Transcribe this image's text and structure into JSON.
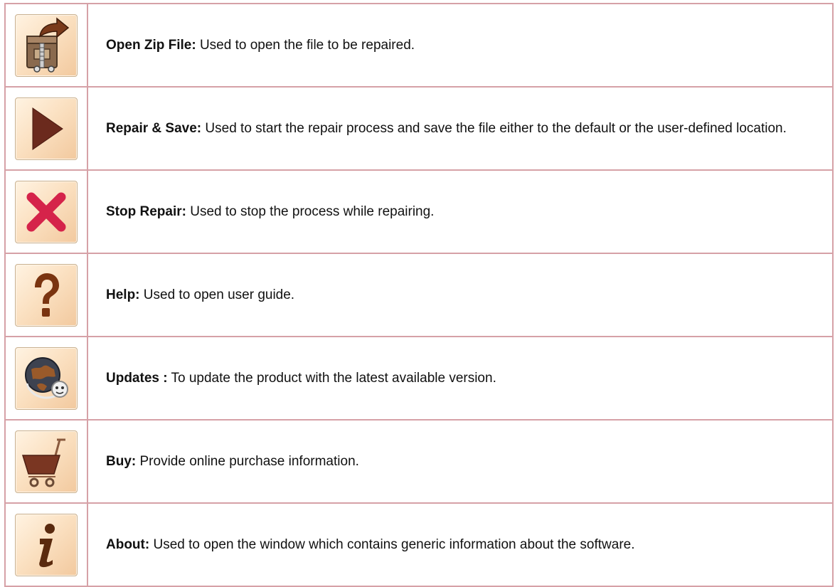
{
  "rows": [
    {
      "icon": "open-zip-file-icon",
      "label": "Open Zip File:",
      "description": " Used to open the file to be repaired."
    },
    {
      "icon": "play-icon",
      "label": "Repair & Save:",
      "description": " Used to start the repair process and save the file either to the default or the user-defined location."
    },
    {
      "icon": "close-icon",
      "label": "Stop Repair:",
      "description": " Used to stop the process while repairing."
    },
    {
      "icon": "question-icon",
      "label": "Help:",
      "description": " Used to open user guide."
    },
    {
      "icon": "globe-update-icon",
      "label": "Updates :",
      "description": " To update the product with the latest available version."
    },
    {
      "icon": "shopping-cart-icon",
      "label": "Buy:",
      "description": " Provide online purchase information."
    },
    {
      "icon": "info-icon",
      "label": "About:",
      "description": " Used to open the window which contains generic information about the software."
    }
  ],
  "colors": {
    "border": "#d6a1a7",
    "button_bg": "#fbe1c2",
    "play": "#6b2a1d",
    "stop": "#d5234a",
    "help": "#7a3410",
    "info": "#5a2a0e"
  }
}
